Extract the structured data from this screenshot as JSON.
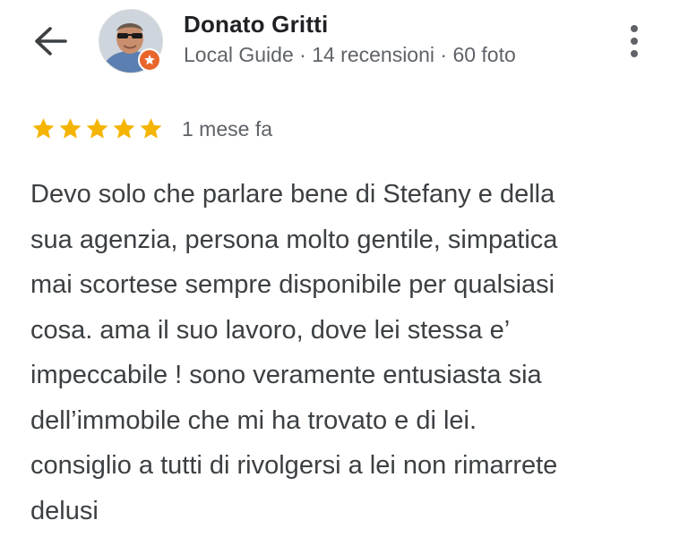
{
  "header": {
    "back_icon": "arrow-back-icon",
    "reviewer_name": "Donato Gritti",
    "reviewer_meta": "Local Guide · 14 recensioni · 60 foto",
    "more_icon": "more-vertical-icon",
    "badge_color": "#e8662b"
  },
  "review": {
    "rating": 5,
    "rating_max": 5,
    "star_color": "#f4b400",
    "time_ago": "1 mese fa",
    "text_lines": [
      "Devo solo che parlare bene di Stefany e della",
      "sua agenzia, persona molto gentile, simpatica",
      "mai scortese sempre disponibile per qualsiasi",
      "cosa. ama il suo lavoro, dove lei stessa e’",
      "impeccabile ! sono veramente entusiasta sia",
      "dell’immobile che mi ha trovato e di lei.",
      "consiglio a tutti di rivolgersi a lei non rimarrete",
      "delusi"
    ]
  }
}
